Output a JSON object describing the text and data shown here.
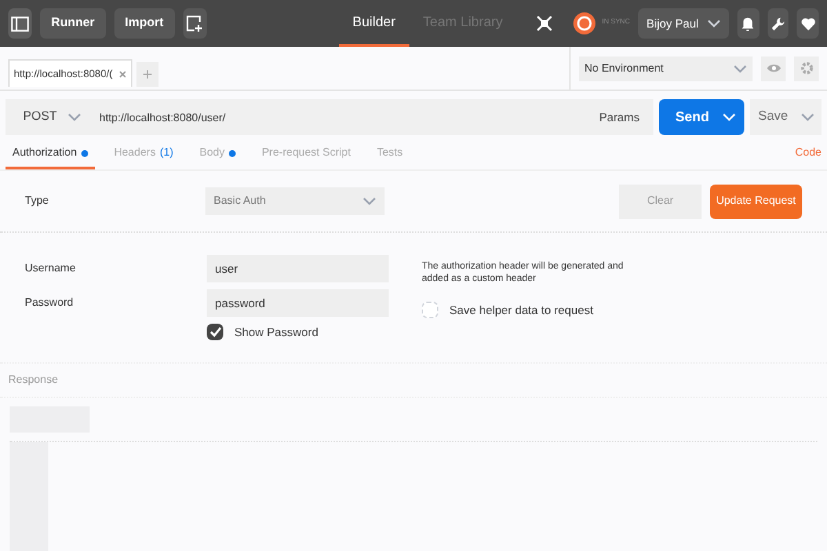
{
  "header": {
    "buttons": [
      "Runner",
      "Import"
    ],
    "nav": [
      {
        "label": "Builder",
        "selected": true
      },
      {
        "label": "Team Library",
        "selected": false
      }
    ],
    "sync": "IN SYNC",
    "user": "Bijoy Paul"
  },
  "request_tabs": [
    {
      "label": "http://localhost:8080/(",
      "selected": true
    }
  ],
  "environment": "No Environment",
  "request": {
    "method": "POST",
    "url": "http://localhost:8080/user/",
    "params": "Params",
    "send": "Send",
    "save": "Save"
  },
  "tabs": [
    {
      "label": "Authorization",
      "selected": true,
      "dot": true
    },
    {
      "label": "Headers",
      "selected": false,
      "dot": false,
      "count": "(1)"
    },
    {
      "label": "Body",
      "selected": false,
      "dot": true
    },
    {
      "label": "Pre-request Script",
      "selected": false,
      "dot": false
    },
    {
      "label": "Tests",
      "selected": false,
      "dot": false
    }
  ],
  "code_link": "Code",
  "auth": {
    "type_label": "Type",
    "type_value": "Basic Auth",
    "clear": "Clear",
    "update": "Update Request",
    "username_label": "Username",
    "username": "user",
    "password_label": "Password",
    "password": "password",
    "show_password": {
      "label": "Show Password",
      "checked": true
    },
    "note": "The authorization header will be generated and added as a custom header",
    "save_helper": {
      "label": "Save helper data to request",
      "checked": false
    }
  },
  "response": {
    "title": "Response"
  }
}
